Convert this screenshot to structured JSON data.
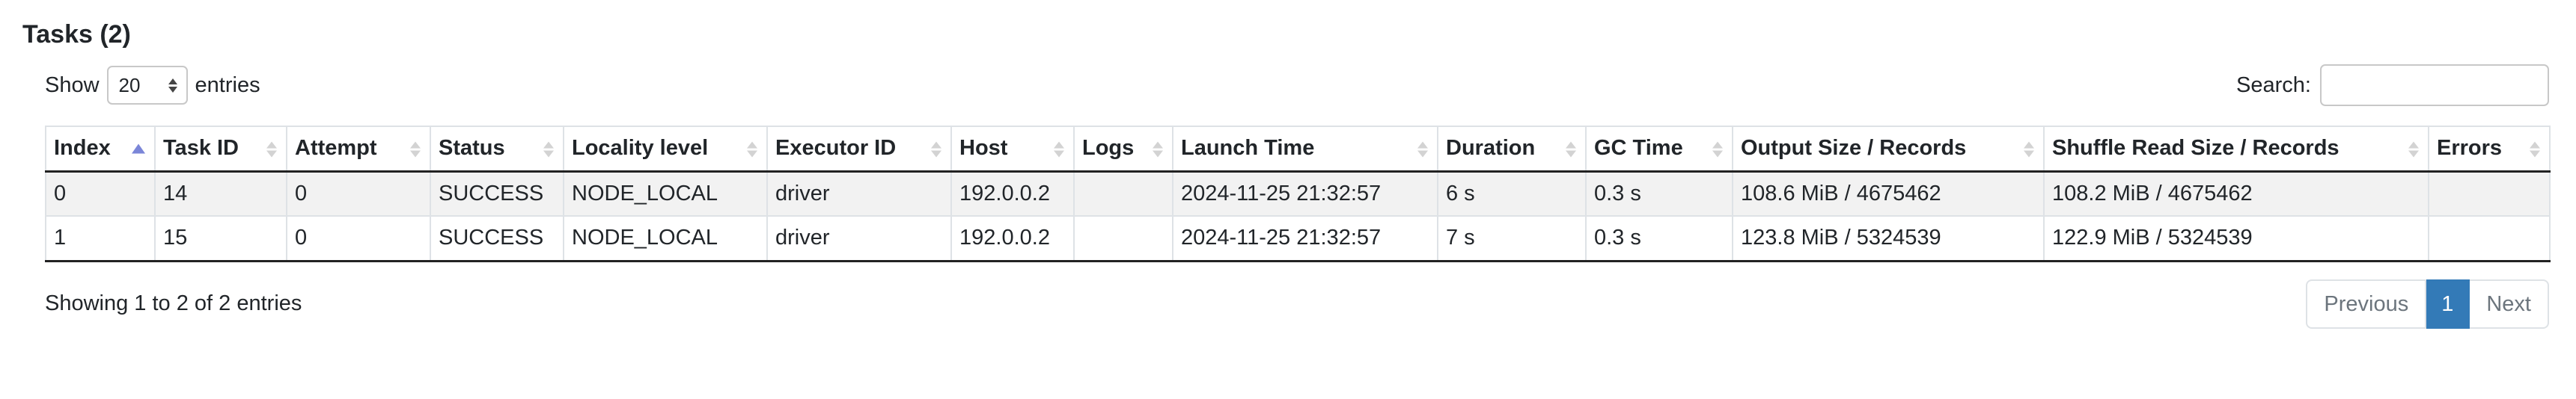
{
  "title": "Tasks (2)",
  "length": {
    "prefix": "Show",
    "value": "20",
    "suffix": "entries"
  },
  "search": {
    "label": "Search:",
    "value": "",
    "placeholder": ""
  },
  "table": {
    "columns": [
      "Index",
      "Task ID",
      "Attempt",
      "Status",
      "Locality level",
      "Executor ID",
      "Host",
      "Logs",
      "Launch Time",
      "Duration",
      "GC Time",
      "Output Size / Records",
      "Shuffle Read Size / Records",
      "Errors"
    ],
    "sorted_column": "Index",
    "sort_direction": "ascending",
    "rows": [
      [
        "0",
        "14",
        "0",
        "SUCCESS",
        "NODE_LOCAL",
        "driver",
        "192.0.0.2",
        "",
        "2024-11-25 21:32:57",
        "6 s",
        "0.3 s",
        "108.6 MiB / 4675462",
        "108.2 MiB / 4675462",
        ""
      ],
      [
        "1",
        "15",
        "0",
        "SUCCESS",
        "NODE_LOCAL",
        "driver",
        "192.0.0.2",
        "",
        "2024-11-25 21:32:57",
        "7 s",
        "0.3 s",
        "123.8 MiB / 5324539",
        "122.9 MiB / 5324539",
        ""
      ]
    ]
  },
  "info": "Showing 1 to 2 of 2 entries",
  "pagination": {
    "previous": "Previous",
    "current": "1",
    "next": "Next"
  },
  "colors": {
    "active_page": "#337ab7",
    "sort_active": "#7b86d8",
    "row_stripe": "#f2f2f2"
  },
  "icons": {
    "select_arrows": "updown-arrows-icon",
    "sort": "sort-both-icon",
    "sort_active": "sort-asc-icon"
  }
}
